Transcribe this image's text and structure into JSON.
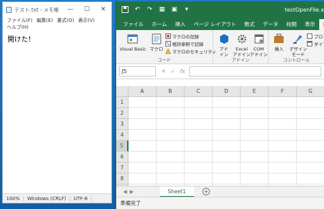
{
  "notepad": {
    "title": "テスト.txt - メモ帳",
    "menu": [
      "ファイル(F)",
      "編集(E)",
      "書式(O)",
      "表示(V)",
      "ヘルプ(H)"
    ],
    "content": "開けた！",
    "status": [
      "100%",
      "Windows (CRLF)",
      "UTF-8"
    ]
  },
  "excel": {
    "title": "testOpenFile.x",
    "tabs": [
      "ファイル",
      "ホーム",
      "挿入",
      "ページ レイアウト",
      "数式",
      "データ",
      "校閲",
      "表示",
      "開発"
    ],
    "active_tab": "開発",
    "ribbon": {
      "code_group": "コード",
      "visual_basic": "Visual Basic",
      "macro": "マクロ",
      "record_macro": "マクロの記録",
      "relative_ref": "相対参照で記録",
      "macro_security": "マクロのセキュリティ",
      "addins_group": "アドイン",
      "addin": "アド\nイン",
      "excel_addin": "Excel\nアドイン",
      "com_addin": "COM\nアドイン",
      "controls_group": "コントロール",
      "insert": "挿入",
      "design_mode": "デザイン\nモード",
      "properties": "プロ",
      "dialog": "ダイア"
    },
    "namebox": "J5",
    "columns": [
      "A",
      "B",
      "C",
      "D",
      "E",
      "F",
      "G"
    ],
    "rows": [
      "1",
      "2",
      "3",
      "4",
      "5",
      "6",
      "7",
      "8",
      "9"
    ],
    "selected_row": "5",
    "sheet_tab": "Sheet1",
    "status": "準備完了",
    "accent": "#217346"
  }
}
